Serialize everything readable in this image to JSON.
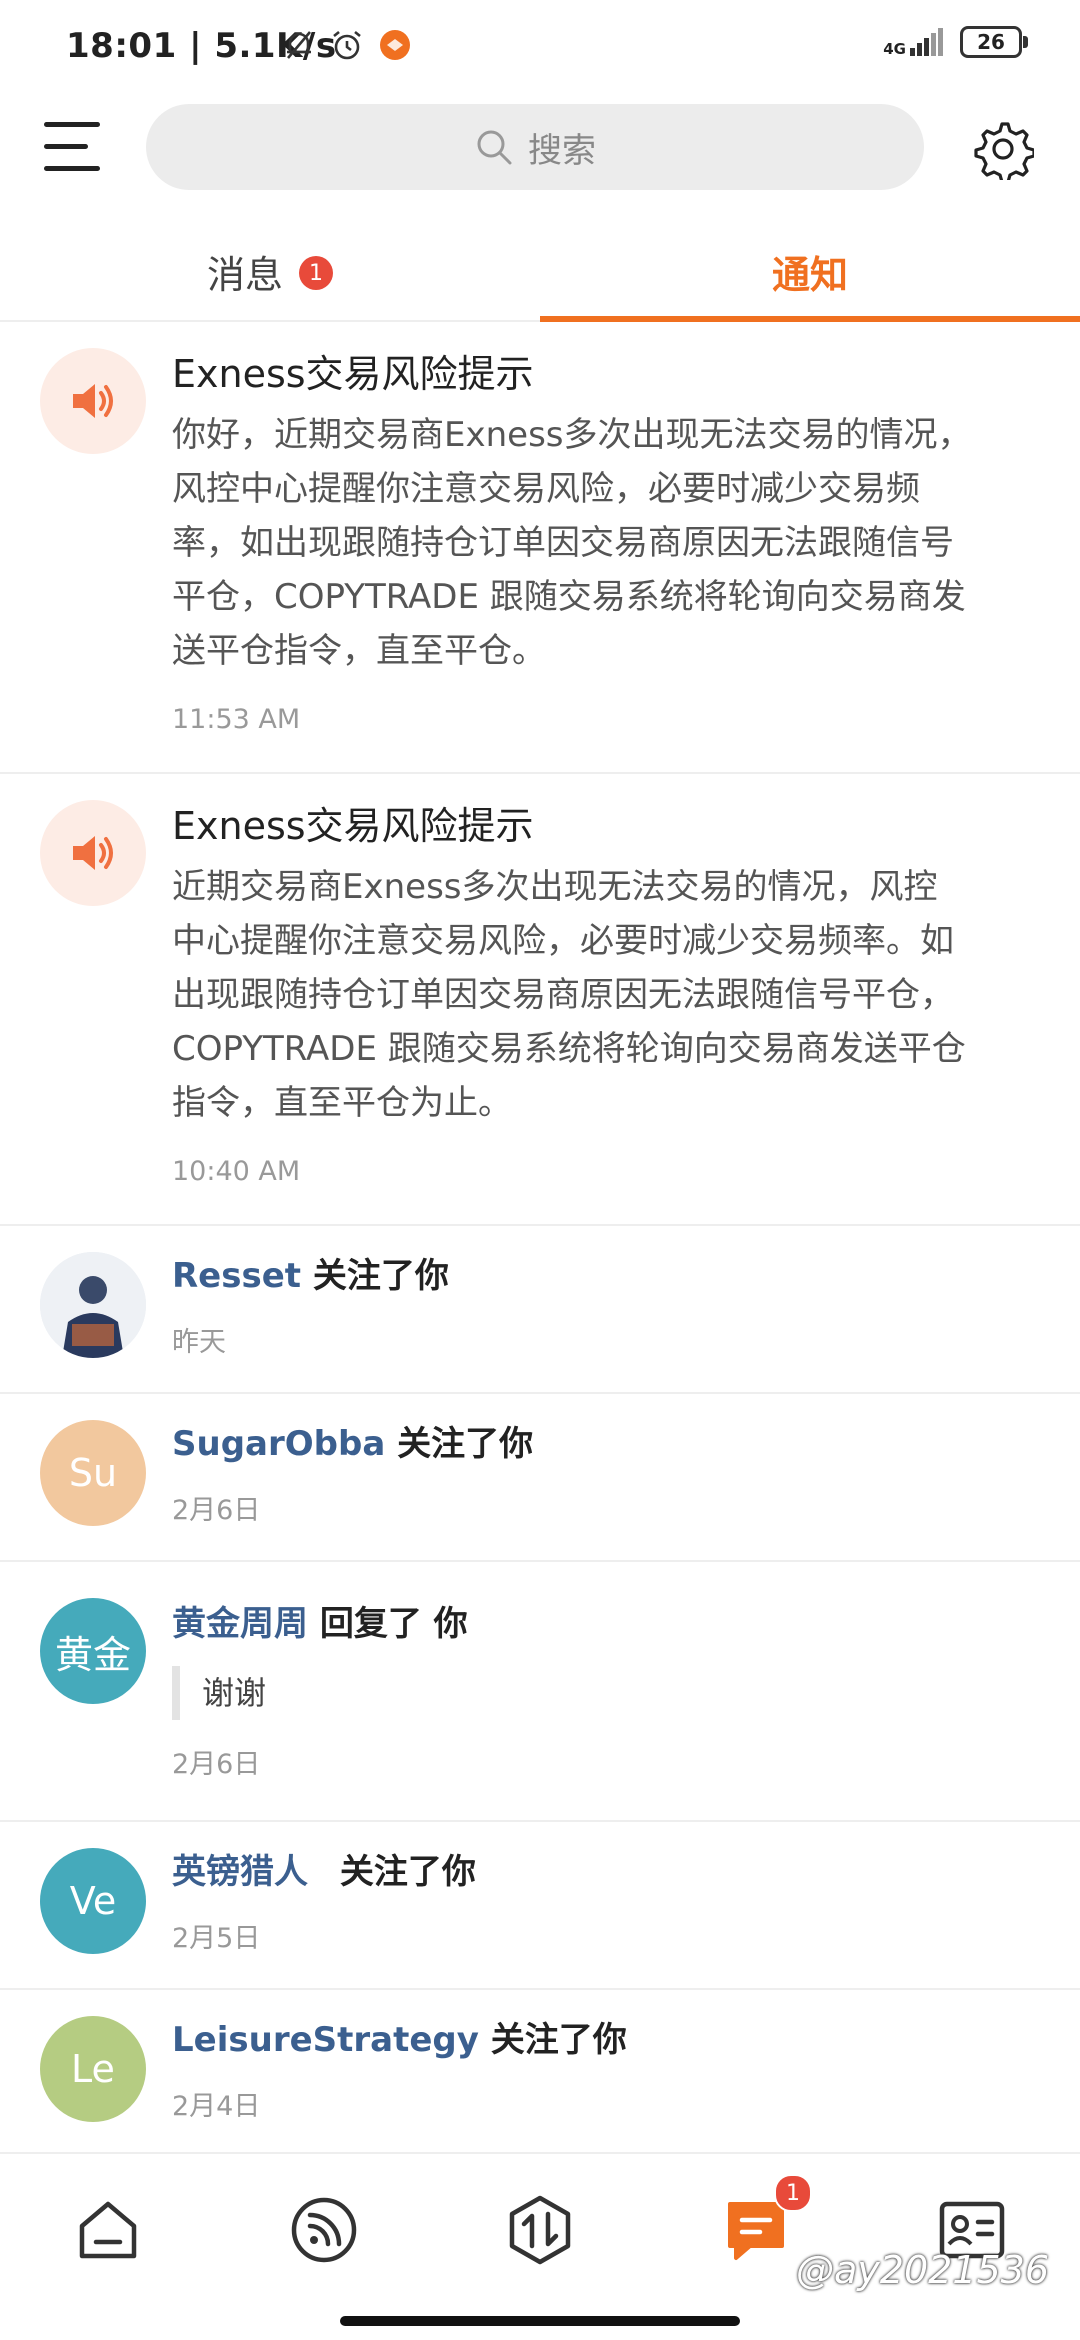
{
  "status_bar": {
    "time": "18:01",
    "speed": "5.1K/s",
    "network": "4G",
    "battery": "26"
  },
  "search": {
    "placeholder": "搜索"
  },
  "tabs": [
    {
      "label": "消息",
      "badge": "1"
    },
    {
      "label": "通知"
    }
  ],
  "notices": [
    {
      "title": "Exness交易风险提示",
      "body_lines": [
        "你好，近期交易商Exness多次出现无法交易的情况，",
        "风控中心提醒你注意交易风险，必要时减少交易频",
        "率，如出现跟随持仓订单因交易商原因无法跟随信号",
        "平仓，COPYTRADE 跟随交易系统将轮询向交易商发",
        "送平仓指令，直至平仓。"
      ],
      "time": "11:53 AM"
    },
    {
      "title": "Exness交易风险提示",
      "body_lines": [
        "近期交易商Exness多次出现无法交易的情况，风控",
        "中心提醒你注意交易风险，必要时减少交易频率。如",
        "出现跟随持仓订单因交易商原因无法跟随信号平仓，",
        "COPYTRADE 跟随交易系统将轮询向交易商发送平仓",
        "指令，直至平仓为止。"
      ],
      "time": "10:40 AM"
    }
  ],
  "activities": [
    {
      "avatar": "",
      "user": "Resset",
      "action": "关注了你",
      "time": "昨天"
    },
    {
      "avatar": "Su",
      "avatar_color": "#f2c89e",
      "user": "SugarObba",
      "action": "关注了你",
      "time": "2月6日"
    },
    {
      "avatar": "黄金",
      "avatar_color": "#45aabb",
      "user": "黄金周周",
      "action": "回复了 你",
      "quote": "谢谢",
      "time": "2月6日"
    },
    {
      "avatar": "Ve",
      "avatar_color": "#45aabb",
      "user": "英镑猎人",
      "action": "关注了你",
      "time": "2月5日"
    },
    {
      "avatar": "Le",
      "avatar_color": "#b5cc82",
      "user": "LeisureStrategy",
      "action": "关注了你",
      "time": "2月4日"
    }
  ],
  "bottom_nav": [
    {
      "icon": "home-icon"
    },
    {
      "icon": "feed-icon"
    },
    {
      "icon": "trade-icon"
    },
    {
      "icon": "messages-icon",
      "badge": "1",
      "active": true
    },
    {
      "icon": "profile-card-icon"
    }
  ],
  "watermark": "@ay2021536",
  "colors": {
    "accent": "#f07020",
    "username": "#3b5f8f",
    "badge": "#e84a3a"
  }
}
